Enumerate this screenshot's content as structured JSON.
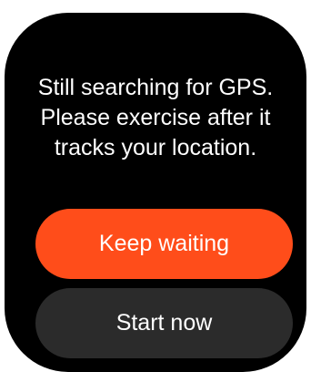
{
  "dialog": {
    "message_lines": [
      "Still searching for GPS.",
      "Please exercise after it",
      "tracks your location."
    ],
    "primary_button_label": "Keep waiting",
    "secondary_button_label": "Start now"
  },
  "colors": {
    "background": "#000000",
    "primary_button": "#ff4d1a",
    "secondary_button": "#2b2b2b",
    "text": "#ffffff"
  }
}
